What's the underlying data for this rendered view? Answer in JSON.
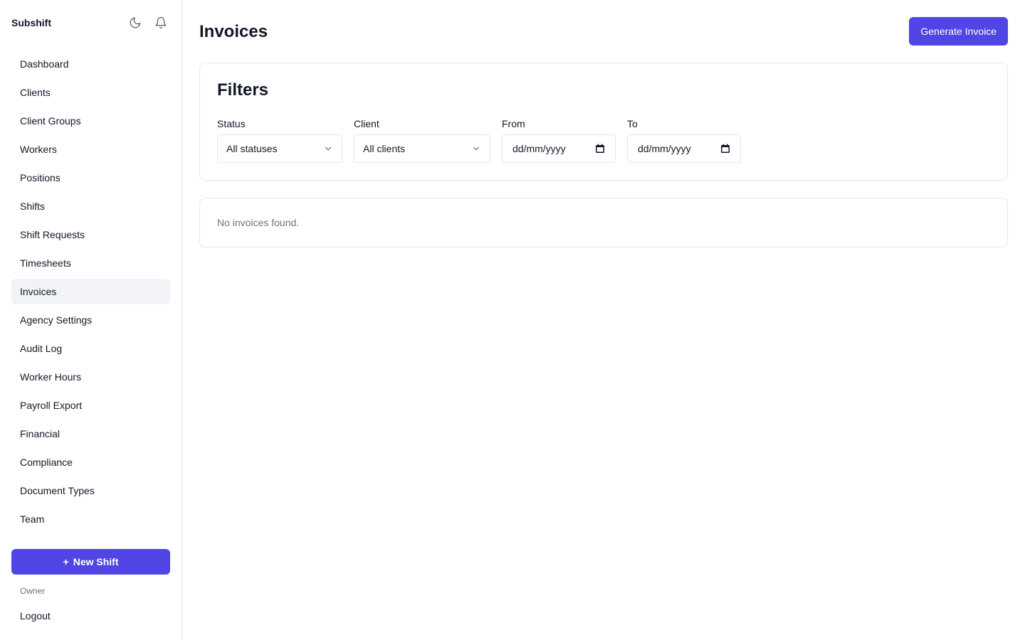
{
  "app": {
    "name": "Subshift"
  },
  "header_icons": [
    "moon-icon",
    "bell-icon"
  ],
  "sidebar": {
    "items": [
      {
        "label": "Dashboard",
        "active": false
      },
      {
        "label": "Clients",
        "active": false
      },
      {
        "label": "Client Groups",
        "active": false
      },
      {
        "label": "Workers",
        "active": false
      },
      {
        "label": "Positions",
        "active": false
      },
      {
        "label": "Shifts",
        "active": false
      },
      {
        "label": "Shift Requests",
        "active": false
      },
      {
        "label": "Timesheets",
        "active": false
      },
      {
        "label": "Invoices",
        "active": true
      },
      {
        "label": "Agency Settings",
        "active": false
      },
      {
        "label": "Audit Log",
        "active": false
      },
      {
        "label": "Worker Hours",
        "active": false
      },
      {
        "label": "Payroll Export",
        "active": false
      },
      {
        "label": "Financial",
        "active": false
      },
      {
        "label": "Compliance",
        "active": false
      },
      {
        "label": "Document Types",
        "active": false
      },
      {
        "label": "Team",
        "active": false
      }
    ],
    "new_shift_plus": "+",
    "new_shift_label": "New Shift",
    "role": "Owner",
    "logout": "Logout"
  },
  "page": {
    "title": "Invoices",
    "generate_button": "Generate Invoice"
  },
  "filters": {
    "title": "Filters",
    "status": {
      "label": "Status",
      "value": "All statuses"
    },
    "client": {
      "label": "Client",
      "value": "All clients"
    },
    "from": {
      "label": "From",
      "placeholder": "dd/mm/yyyy"
    },
    "to": {
      "label": "To",
      "placeholder": "dd/mm/yyyy"
    }
  },
  "results": {
    "empty_message": "No invoices found."
  },
  "colors": {
    "accent": "#4f46e5",
    "active_nav_bg": "#f1f3f6",
    "border": "#e5e7eb",
    "muted_text": "#6b7280"
  }
}
